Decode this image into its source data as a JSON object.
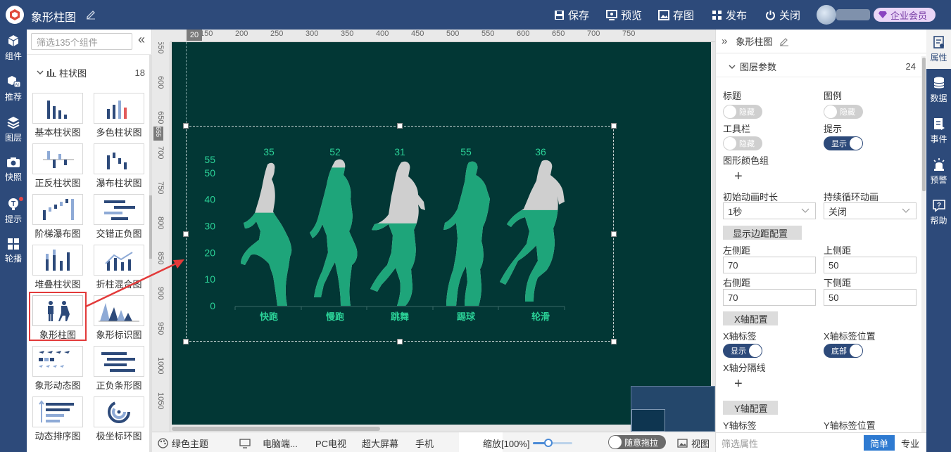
{
  "app": {
    "title": "象形柱图",
    "toolbar": {
      "save": "保存",
      "preview": "预览",
      "screenshot": "存图",
      "publish": "发布",
      "close": "关闭",
      "vip": "企业会员"
    }
  },
  "left_rail": [
    {
      "label": "组件",
      "icon": "cube-icon"
    },
    {
      "label": "推荐",
      "icon": "ai-cube-icon"
    },
    {
      "label": "图层",
      "icon": "layers-icon"
    },
    {
      "label": "快照",
      "icon": "camera-icon"
    },
    {
      "label": "提示",
      "icon": "tip-icon"
    },
    {
      "label": "轮播",
      "icon": "windows-icon"
    }
  ],
  "components": {
    "search_placeholder": "筛选135个组件",
    "category": {
      "name": "柱状图",
      "count": "18"
    },
    "tiles": [
      {
        "label": "基本柱状图"
      },
      {
        "label": "多色柱状图"
      },
      {
        "label": "正反柱状图"
      },
      {
        "label": "瀑布柱状图"
      },
      {
        "label": "阶梯瀑布图"
      },
      {
        "label": "交错正负图"
      },
      {
        "label": "堆叠柱状图"
      },
      {
        "label": "折柱混合图"
      },
      {
        "label": "象形柱图"
      },
      {
        "label": "象形标识图"
      },
      {
        "label": "象形动态图"
      },
      {
        "label": "正负条形图"
      },
      {
        "label": "动态排序图"
      },
      {
        "label": "极坐标环图"
      }
    ]
  },
  "rulers": {
    "top_ticks": [
      "150",
      "200",
      "250",
      "300",
      "350",
      "400",
      "450",
      "500",
      "550",
      "600",
      "650",
      "700",
      "750"
    ],
    "top_marker": "20",
    "left_ticks": [
      "550",
      "600",
      "650",
      "700",
      "750",
      "800",
      "850",
      "900",
      "950",
      "1000",
      "1050"
    ],
    "left_marker": "655"
  },
  "chart_data": {
    "type": "bar",
    "categories": [
      "快跑",
      "慢跑",
      "跳舞",
      "踢球",
      "轮滑"
    ],
    "values": [
      35,
      52,
      31,
      55,
      36
    ],
    "ylim": [
      0,
      55
    ],
    "yticks": [
      "0",
      "10",
      "20",
      "30",
      "40",
      "50",
      "55"
    ],
    "colors": {
      "fill": "#1ea57a",
      "empty": "#cfcfcf",
      "text": "#2bd197",
      "background": "#023735"
    }
  },
  "bottom_bar": {
    "theme": "绿色主题",
    "devices": [
      "电脑端...",
      "PC电视",
      "超大屏幕",
      "手机"
    ],
    "zoom_label": "缩放[100%]",
    "zoom_level": 0.4,
    "drag": "随意拖拉",
    "view": "视图"
  },
  "props": {
    "title": "象形柱图",
    "layer_params": "图层参数",
    "layer_count": "24",
    "labels": {
      "title": "标题",
      "legend": "图例",
      "toolbar": "工具栏",
      "tooltip": "提示",
      "color_group": "图形颜色组",
      "anim_duration": "初始动画时长",
      "loop_anim": "持续循环动画",
      "margin_section": "显示边距配置",
      "left": "左侧距",
      "top": "上侧距",
      "right": "右侧距",
      "bottom": "下侧距",
      "xaxis_section": "X轴配置",
      "x_label": "X轴标签",
      "x_label_pos": "X轴标签位置",
      "x_split": "X轴分隔线",
      "yaxis_section": "Y轴配置",
      "y_label": "Y轴标签",
      "y_label_pos": "Y轴标签位置"
    },
    "values": {
      "title_toggle": "隐藏",
      "legend_toggle": "隐藏",
      "toolbar_toggle": "隐藏",
      "tooltip_toggle": "显示",
      "anim_duration": "1秒",
      "loop_anim": "关闭",
      "left": "70",
      "top": "50",
      "right": "70",
      "bottom": "50",
      "x_label_toggle": "显示",
      "x_label_pos_toggle": "底部"
    },
    "filter_placeholder": "筛选属性",
    "mode_simple": "简单",
    "mode_pro": "专业"
  },
  "right_rail": [
    {
      "label": "属性",
      "icon": "property-icon"
    },
    {
      "label": "数据",
      "icon": "database-icon"
    },
    {
      "label": "事件",
      "icon": "event-icon"
    },
    {
      "label": "预警",
      "icon": "alarm-icon"
    },
    {
      "label": "帮助",
      "icon": "help-icon"
    }
  ]
}
